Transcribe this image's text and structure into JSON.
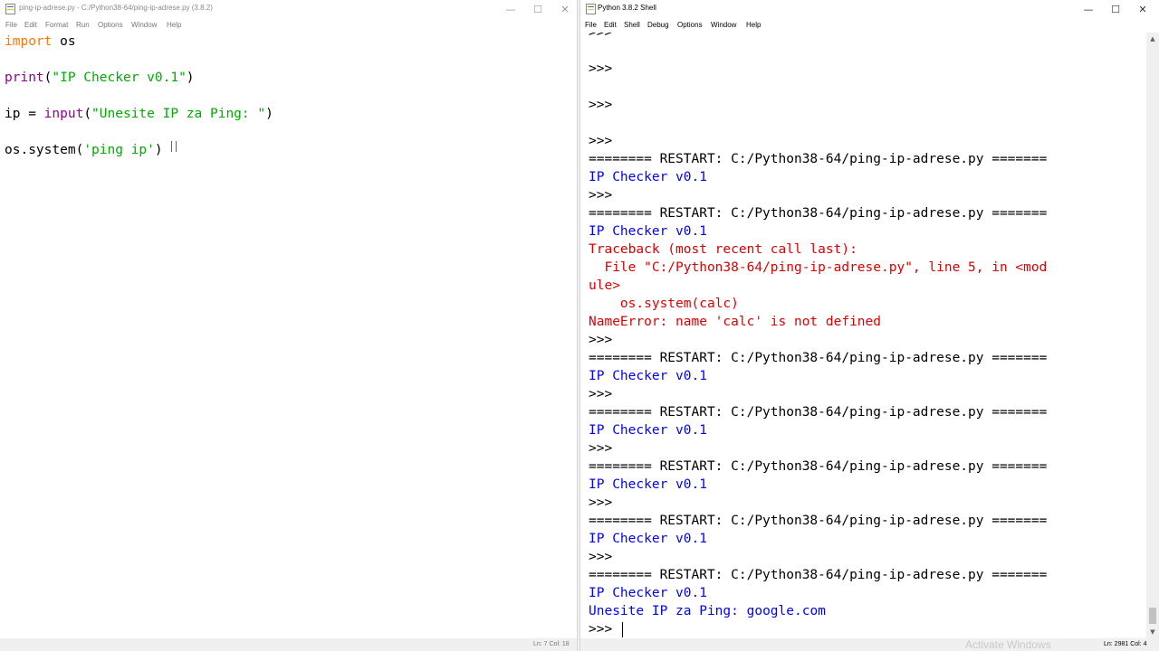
{
  "editor": {
    "title": "ping-ip-adrese.py - C:/Python38-64/ping-ip-adrese.py (3.8.2)",
    "menu": [
      "File",
      "Edit",
      "Format",
      "Run",
      "Options",
      "Window",
      "Help"
    ],
    "code": {
      "line1_kw": "import",
      "line1_rest": " os",
      "line2_fn": "print",
      "line2_open": "(",
      "line2_str": "\"IP Checker v0.1\"",
      "line2_close": ")",
      "line3_pre": "ip = ",
      "line3_fn": "input",
      "line3_open": "(",
      "line3_str": "\"Unesite IP za Ping: \"",
      "line3_close": ")",
      "line4_pre": "os.system(",
      "line4_str": "'ping ip'",
      "line4_close": ")"
    },
    "status": "Ln: 7   Col: 18"
  },
  "shell": {
    "title": "Python 3.8.2 Shell",
    "menu": [
      "File",
      "Edit",
      "Shell",
      "Debug",
      "Options",
      "Window",
      "Help"
    ],
    "lines": {
      "partial_prompt": ">>>",
      "prompt": ">>>",
      "restart": "======== RESTART: C:/Python38-64/ping-ip-adrese.py =======",
      "output": "IP Checker v0.1",
      "traceback_header": "Traceback (most recent call last):",
      "traceback_file": "  File \"C:/Python38-64/ping-ip-adrese.py\", line 5, in <mod",
      "traceback_module": "ule>",
      "traceback_code": "    os.system(calc)",
      "name_error": "NameError: name 'calc' is not defined",
      "input_prompt": "Unesite IP za Ping: ",
      "input_value": "google.com",
      "final_prompt": ">>> "
    },
    "status": "Ln: 2981   Col: 4"
  },
  "window_controls": {
    "minimize": "—",
    "maximize": "☐",
    "close": "✕"
  },
  "watermark": "Activate Windows",
  "colors": {
    "keyword": "#ff7700",
    "builtin": "#900090",
    "string": "#00aa00",
    "output": "#0000ff",
    "error": "#dd0000"
  }
}
